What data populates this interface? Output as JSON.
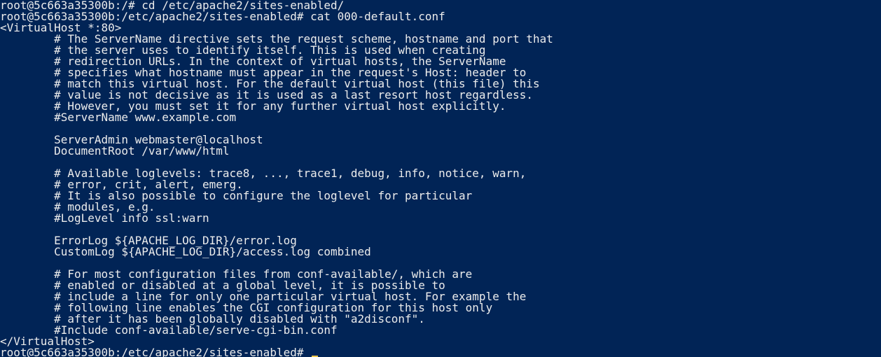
{
  "terminal": {
    "background": "#012456",
    "foreground": "#ececec",
    "cursor_color": "#f2c94c",
    "lines": [
      "root@5c663a35300b:/# cd /etc/apache2/sites-enabled/",
      "root@5c663a35300b:/etc/apache2/sites-enabled# cat 000-default.conf",
      "<VirtualHost *:80>",
      "        # The ServerName directive sets the request scheme, hostname and port that",
      "        # the server uses to identify itself. This is used when creating",
      "        # redirection URLs. In the context of virtual hosts, the ServerName",
      "        # specifies what hostname must appear in the request's Host: header to",
      "        # match this virtual host. For the default virtual host (this file) this",
      "        # value is not decisive as it is used as a last resort host regardless.",
      "        # However, you must set it for any further virtual host explicitly.",
      "        #ServerName www.example.com",
      "",
      "        ServerAdmin webmaster@localhost",
      "        DocumentRoot /var/www/html",
      "",
      "        # Available loglevels: trace8, ..., trace1, debug, info, notice, warn,",
      "        # error, crit, alert, emerg.",
      "        # It is also possible to configure the loglevel for particular",
      "        # modules, e.g.",
      "        #LogLevel info ssl:warn",
      "",
      "        ErrorLog ${APACHE_LOG_DIR}/error.log",
      "        CustomLog ${APACHE_LOG_DIR}/access.log combined",
      "",
      "        # For most configuration files from conf-available/, which are",
      "        # enabled or disabled at a global level, it is possible to",
      "        # include a line for only one particular virtual host. For example the",
      "        # following line enables the CGI configuration for this host only",
      "        # after it has been globally disabled with \"a2disconf\".",
      "        #Include conf-available/serve-cgi-bin.conf",
      "</VirtualHost>"
    ],
    "prompt": "root@5c663a35300b:/etc/apache2/sites-enabled# "
  }
}
